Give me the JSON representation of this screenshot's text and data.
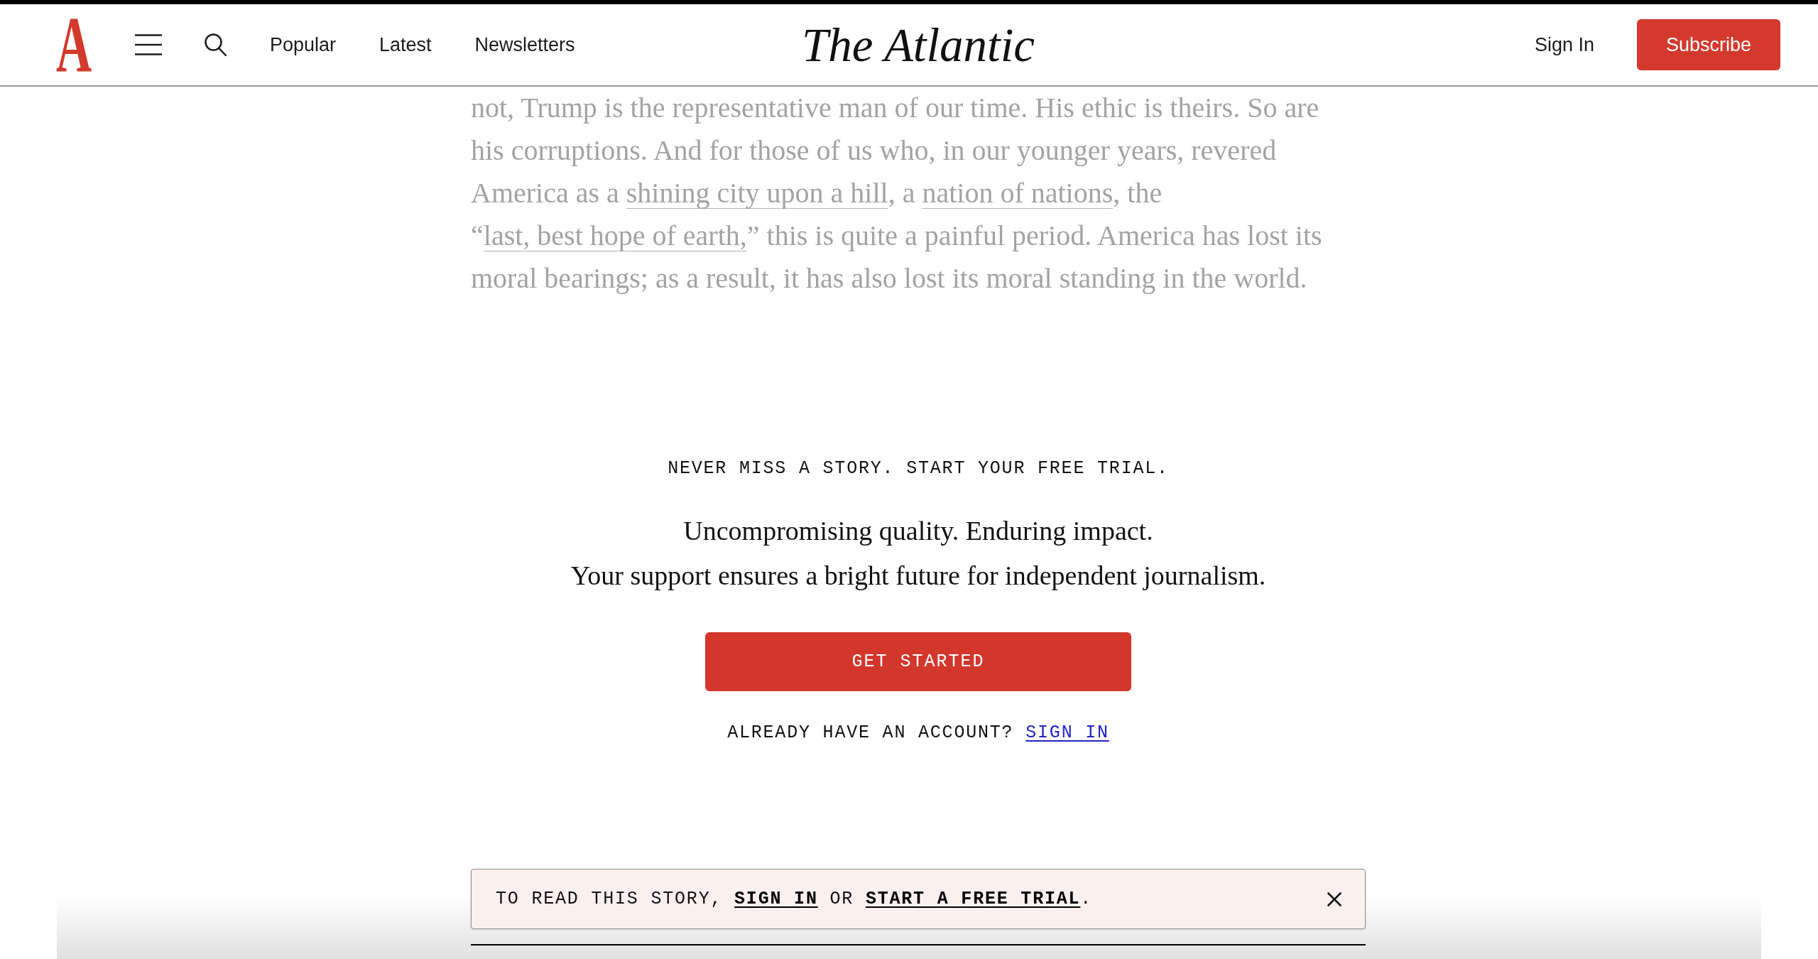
{
  "header": {
    "logo": "A",
    "nav": [
      "Popular",
      "Latest",
      "Newsletters"
    ],
    "wordmark": "The Atlantic",
    "sign_in": "Sign In",
    "subscribe": "Subscribe"
  },
  "article": {
    "paragraph": [
      {
        "kind": "text",
        "text": "not, Trump is the representative man of our time. His ethic is theirs. So are his corruptions. And for those of us who, in our younger years, revered America as a "
      },
      {
        "kind": "link",
        "text": "shining city upon a hill"
      },
      {
        "kind": "text",
        "text": ", a "
      },
      {
        "kind": "link",
        "text": "nation of nations"
      },
      {
        "kind": "text",
        "text": ", the “"
      },
      {
        "kind": "link",
        "text": "last, best hope of earth,"
      },
      {
        "kind": "text",
        "text": "” this is quite a painful period. America has lost its moral bearings; as a result, it has also lost its moral standing in the world."
      }
    ]
  },
  "paywall": {
    "eyebrow": "NEVER MISS A STORY. START YOUR FREE TRIAL.",
    "taglines": [
      "Uncompromising quality. Enduring impact.",
      "Your support ensures a bright future for independent journalism."
    ],
    "button": "GET STARTED",
    "account_prompt": [
      {
        "kind": "text",
        "text": "ALREADY HAVE AN ACCOUNT? "
      },
      {
        "kind": "link",
        "text": "SIGN IN"
      }
    ]
  },
  "banner": {
    "message": [
      {
        "kind": "text",
        "text": "TO READ THIS STORY, "
      },
      {
        "kind": "link",
        "text": "SIGN IN"
      },
      {
        "kind": "text",
        "text": " OR "
      },
      {
        "kind": "link",
        "text": "START A FREE TRIAL"
      },
      {
        "kind": "text",
        "text": "."
      }
    ]
  }
}
